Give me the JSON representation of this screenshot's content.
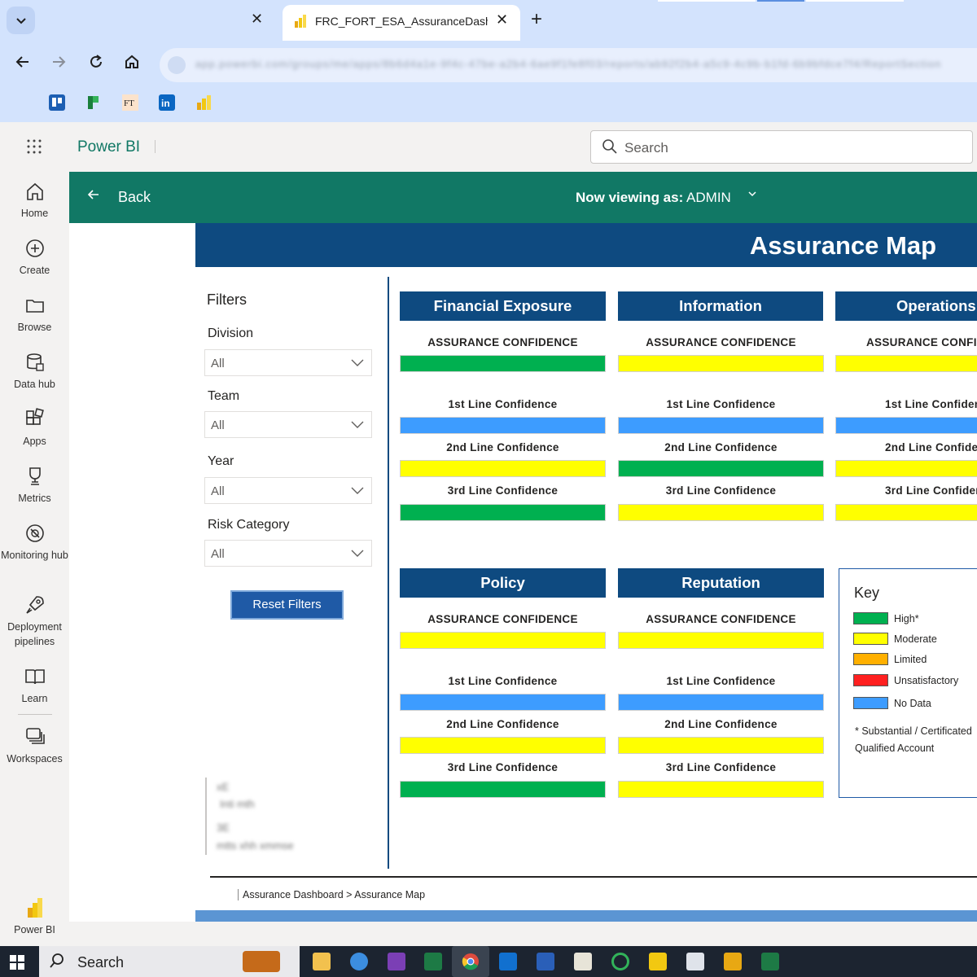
{
  "browser": {
    "active_tab_title": "FRC_FORT_ESA_AssuranceDash",
    "address_url": "app.powerbi.com/groups/me/apps/8b6d4a1e-9f4c-47be-a2b4-6ae9f1fe8f03/reports/ab92f2b4-a5c9-4c9b-b1fd-6b9bfdce7f4/ReportSection",
    "new_tab_symbol": "+",
    "close_symbol": "✕"
  },
  "pbi": {
    "brand": "Power BI",
    "search_placeholder": "Search"
  },
  "leftnav": {
    "items": [
      {
        "label": "Home",
        "icon": "home-icon"
      },
      {
        "label": "Create",
        "icon": "create-icon"
      },
      {
        "label": "Browse",
        "icon": "browse-icon"
      },
      {
        "label": "Data hub",
        "icon": "data-hub-icon"
      },
      {
        "label": "Apps",
        "icon": "apps-icon"
      },
      {
        "label": "Metrics",
        "icon": "metrics-icon"
      },
      {
        "label": "Monitoring hub",
        "icon": "monitoring-icon"
      },
      {
        "label": "Deployment pipelines",
        "icon": "deployment-icon"
      },
      {
        "label": "Learn",
        "icon": "learn-icon"
      },
      {
        "label": "Workspaces",
        "icon": "workspaces-icon"
      }
    ],
    "bottom_label": "Power BI"
  },
  "appbar": {
    "back_label": "Back",
    "viewing_prefix": "Now viewing as:",
    "viewing_role": "ADMIN"
  },
  "report": {
    "title": "Assurance Map",
    "filters": {
      "title": "Filters",
      "items": [
        {
          "label": "Division",
          "value": "All"
        },
        {
          "label": "Team",
          "value": "All"
        },
        {
          "label": "Year",
          "value": "All"
        },
        {
          "label": "Risk Category",
          "value": "All"
        }
      ],
      "reset_label": "Reset Filters"
    },
    "blurred_note": [
      "xE",
      "Inti mth",
      "3E",
      "mtts xhh xmmse"
    ],
    "metric_labels": {
      "assurance": "ASSURANCE CONFIDENCE",
      "first": "1st Line Confidence",
      "second": "2nd Line Confidence",
      "third": "3rd Line Confidence"
    },
    "cards": [
      {
        "title": "Financial Exposure",
        "assurance": "High*",
        "first": "No Data",
        "second": "Moderate",
        "third": "High*"
      },
      {
        "title": "Information",
        "assurance": "Moderate",
        "first": "No Data",
        "second": "High*",
        "third": "Moderate"
      },
      {
        "title": "Operations",
        "assurance": "Moderate",
        "first": "No Data",
        "second": "Moderate",
        "third": "Moderate"
      },
      {
        "title": "Policy",
        "assurance": "Moderate",
        "first": "No Data",
        "second": "Moderate",
        "third": "High*"
      },
      {
        "title": "Reputation",
        "assurance": "Moderate",
        "first": "No Data",
        "second": "Moderate",
        "third": "Moderate"
      }
    ],
    "key": {
      "title": "Key",
      "items": [
        {
          "label": "High*",
          "color": "#00b050"
        },
        {
          "label": "Moderate",
          "color": "#ffff00"
        },
        {
          "label": "Limited",
          "color": "#ffb000"
        },
        {
          "label": "Unsatisfactory",
          "color": "#ff2020"
        },
        {
          "label": "No Data",
          "color": "#3d9cff"
        }
      ],
      "note_line1": "* Substantial / Certificated",
      "note_line2": "Qualified Account"
    },
    "breadcrumb": "Assurance Dashboard > Assurance Map"
  },
  "taskbar": {
    "search_label": "Search"
  }
}
